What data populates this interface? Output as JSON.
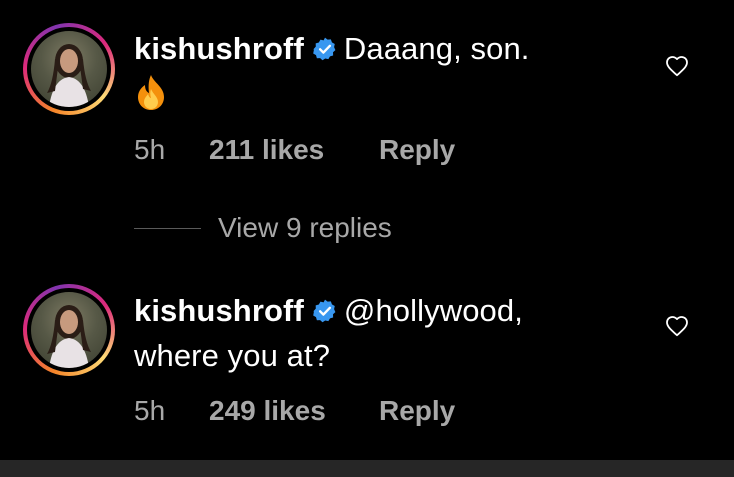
{
  "comments": [
    {
      "username": "kishushroff",
      "text_line1": "Daaang, son.",
      "emoji": "fire-emoji",
      "time": "5h",
      "likes": "211 likes",
      "reply_label": "Reply",
      "verified": true
    },
    {
      "username": "kishushroff",
      "text_line1": "@hollywood,",
      "text_line2": "where you at?",
      "time": "5h",
      "likes": "249 likes",
      "reply_label": "Reply",
      "verified": true
    }
  ],
  "view_replies": {
    "label": "View 9 replies"
  },
  "icons": {
    "verified": "verified-badge-icon",
    "like": "heart-outline-icon",
    "emoji": "fire-emoji"
  },
  "colors": {
    "background": "#000000",
    "text": "#ffffff",
    "secondary_text": "#a8a8a8",
    "verified_blue": "#3897f0",
    "divider": "#5a5a5a"
  }
}
